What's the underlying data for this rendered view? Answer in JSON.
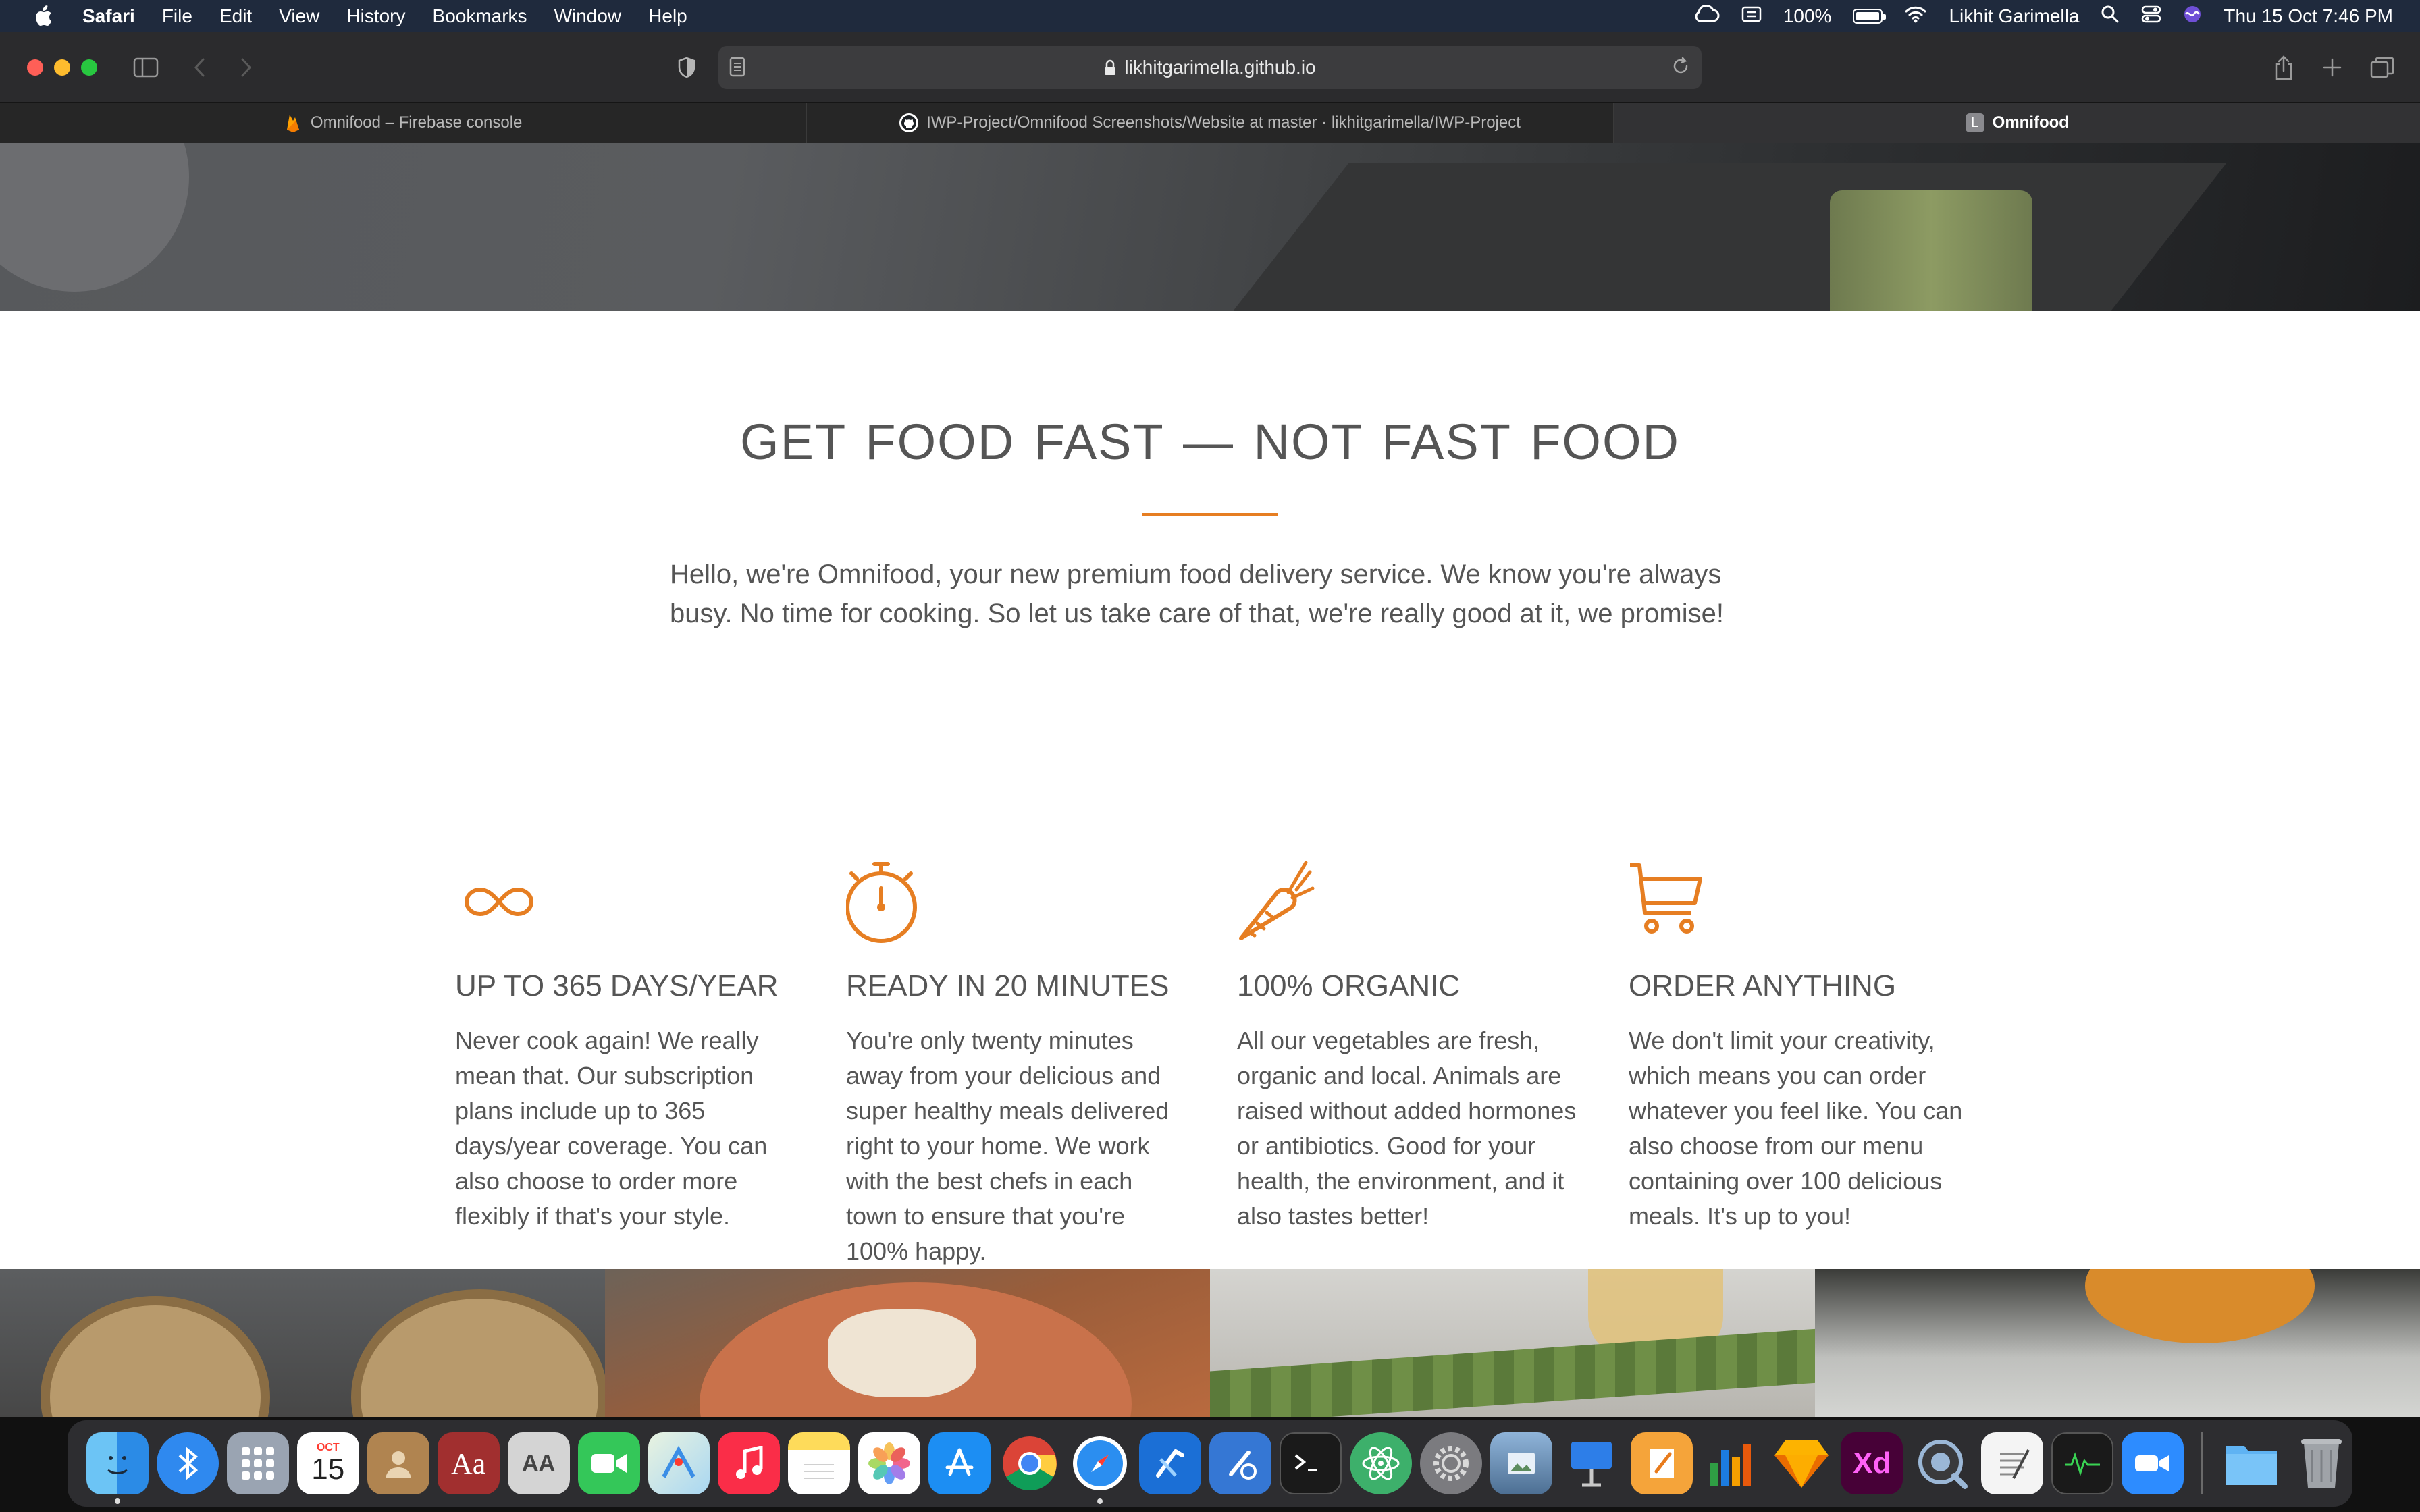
{
  "menubar": {
    "app_name": "Safari",
    "menus": [
      "File",
      "Edit",
      "View",
      "History",
      "Bookmarks",
      "Window",
      "Help"
    ],
    "battery": "100%",
    "user": "Likhit Garimella",
    "datetime": "Thu 15 Oct  7:46 PM"
  },
  "browser": {
    "url": "likhitgarimella.github.io",
    "tabs": [
      {
        "label": "Omnifood – Firebase console",
        "icon": "firebase-icon",
        "active": false
      },
      {
        "label": "IWP-Project/Omnifood Screenshots/Website at master · likhitgarimella/IWP-Project",
        "icon": "github-icon",
        "active": false
      },
      {
        "label": "Omnifood",
        "icon": "letter-l-icon",
        "favicon_letter": "L",
        "active": true
      }
    ]
  },
  "page": {
    "title": "GET FOOD FAST — NOT FAST FOOD",
    "intro": "Hello, we're Omnifood, your new premium food delivery service. We know you're always busy. No time for cooking. So let us take care of that, we're really good at it, we promise!",
    "accent_color": "#e67e22",
    "features": [
      {
        "icon": "infinity-icon",
        "heading": "UP TO 365 DAYS/YEAR",
        "text": "Never cook again! We really mean that. Our subscription plans include up to 365 days/year coverage. You can also choose to order more flexibly if that's your style."
      },
      {
        "icon": "stopwatch-icon",
        "heading": "READY IN 20 MINUTES",
        "text": "You're only twenty minutes away from your delicious and super healthy meals delivered right to your home. We work with the best chefs in each town to ensure that you're 100% happy."
      },
      {
        "icon": "carrot-icon",
        "heading": "100% ORGANIC",
        "text": "All our vegetables are fresh, organic and local. Animals are raised without added hormones or antibiotics. Good for your health, the environment, and it also tastes better!"
      },
      {
        "icon": "cart-icon",
        "heading": "ORDER ANYTHING",
        "text": "We don't limit your creativity, which means you can order whatever you feel like. You can also choose from our menu containing over 100 delicious meals. It's up to you!"
      }
    ],
    "gallery": [
      "dumplings-photo",
      "pizza-photo",
      "asparagus-photo",
      "pumpkin-photo"
    ]
  },
  "dock": {
    "calendar_month": "OCT",
    "calendar_day": "15",
    "dictionary_label": "Aa",
    "fontbook_label": "AA",
    "xd_label": "Xd",
    "apps": [
      "Finder",
      "Bluetooth File Exchange",
      "Launchpad",
      "Calendar",
      "Contacts",
      "Dictionary",
      "Font Book",
      "FaceTime",
      "Maps",
      "Music",
      "Notes",
      "Photos",
      "App Store",
      "Chrome",
      "Safari",
      "Xcode",
      "Instruments",
      "Terminal",
      "Atom",
      "System Preferences",
      "Preview",
      "Keynote",
      "Pages",
      "Numbers",
      "Sketch",
      "Adobe XD",
      "QuickTime Player",
      "TextEdit",
      "Activity Monitor",
      "Zoom",
      "Downloads",
      "Trash"
    ]
  }
}
